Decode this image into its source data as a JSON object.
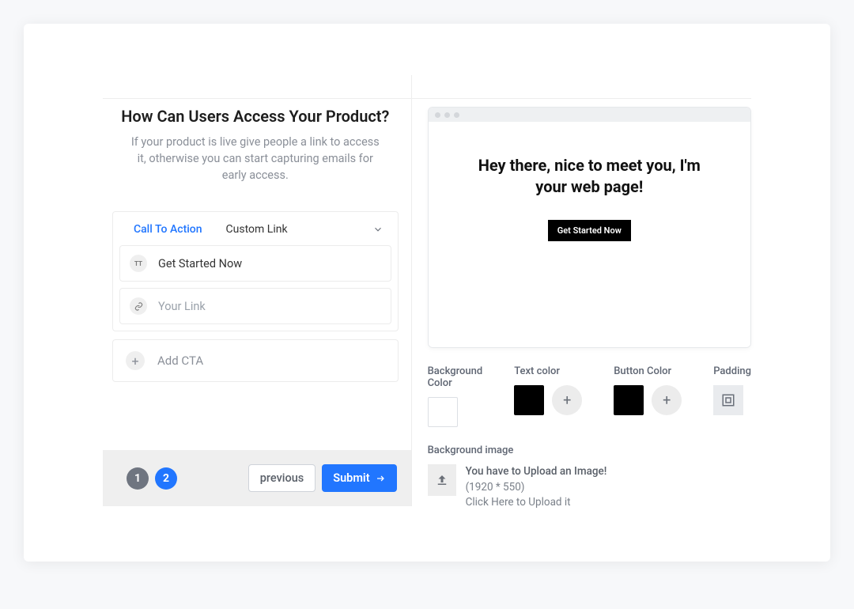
{
  "header": {
    "title": "How Can Users Access Your Product?",
    "subtitle": "If your product is live give people a link to access it, otherwise you can start capturing emails for early access."
  },
  "cta_panel": {
    "label": "Call To Action",
    "select_value": "Custom Link",
    "text_field_value": "Get Started Now",
    "link_field_placeholder": "Your Link",
    "add_button_label": "Add CTA"
  },
  "footer": {
    "step1": "1",
    "step2": "2",
    "previous": "previous",
    "submit": "Submit"
  },
  "preview": {
    "heading": "Hey there, nice to meet you, I'm your web page!",
    "button": "Get Started Now"
  },
  "controls": {
    "bg_color_label": "Background Color",
    "text_color_label": "Text color",
    "button_color_label": "Button Color",
    "padding_label": "Padding",
    "bg_image_label": "Background image"
  },
  "upload": {
    "warning": "You have to Upload an Image!",
    "dimensions": "(1920 * 550)",
    "hint": "Click Here to Upload it"
  }
}
